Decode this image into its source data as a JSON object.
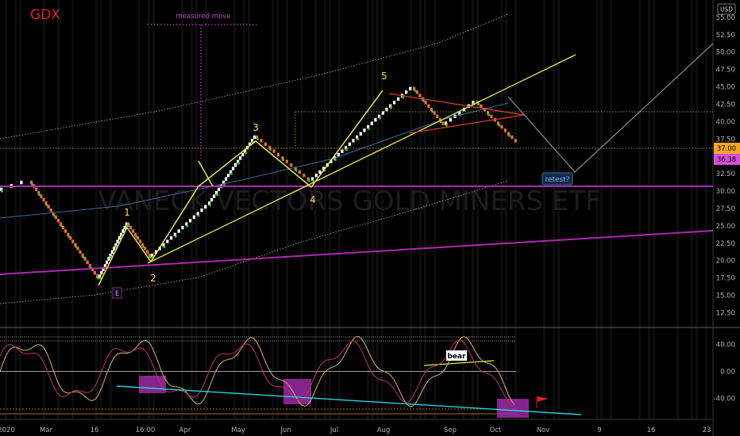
{
  "header": {
    "symbol": "GDX",
    "symbol_color": "#e0212a",
    "currency": "USD",
    "watermark": "VANECK VECTORS GOLD MINERS ETF"
  },
  "price_pane": {
    "y_ticks": [
      12.5,
      15.0,
      17.5,
      20.0,
      22.5,
      25.0,
      27.5,
      30.0,
      32.5,
      35.0,
      37.5,
      40.0,
      42.5,
      45.0,
      47.5,
      50.0,
      52.5,
      55.0
    ],
    "ylim": [
      10.5,
      57.5
    ],
    "last_price": "37.00",
    "last_price_color": "#f5a623",
    "alt_price": "36.38",
    "alt_price_color": "#d64fd8"
  },
  "oscillator_pane": {
    "y_ticks": [
      40.0,
      0.0,
      -40.0
    ],
    "y_tick_labels": [
      "40.00",
      "0.00",
      "-40.00"
    ],
    "ylim": [
      -70,
      62
    ]
  },
  "x_axis": {
    "labels": [
      "2020",
      "Mar",
      "16",
      "16:00",
      "Apr",
      "May",
      "Jun",
      "Jul",
      "Aug",
      "Sep",
      "Oct",
      "Nov",
      "9",
      "16",
      "23"
    ]
  },
  "annotations": {
    "measured_move": "measured move",
    "wave_1": "1",
    "wave_2": "2",
    "wave_3": "3",
    "wave_4": "4",
    "wave_5": "5",
    "retest": "retest?",
    "e_marker": "E",
    "bear": "bear"
  },
  "colors": {
    "up_brick": "#ffffff",
    "down_brick": "#ef6c3c",
    "green_brick": "#32c832",
    "trendline": "#e8e84a",
    "purple_line": "#b027b0",
    "channel": "#9a9a9a",
    "red_wedge": "#d33b2a",
    "cyan_line": "#27d3e0",
    "magenta_box": "#9c2aa6",
    "grid": "#1c1c1c"
  },
  "chart_data": {
    "type": "line",
    "title": "GDX",
    "x": [
      "2020",
      "Mar",
      "16",
      "16:00",
      "Apr",
      "May",
      "Jun",
      "Jul",
      "Aug",
      "Sep",
      "Oct"
    ],
    "series": [
      {
        "values": [
          30.0,
          31.5,
          17.5,
          25.5,
          20.5,
          28.0,
          38.0,
          31.5,
          42.0,
          45.0,
          39.5,
          43.0,
          37.0
        ]
      }
    ],
    "xlabel": "",
    "ylabel": "",
    "ylim": [
      10.5,
      57.5
    ],
    "grid": false,
    "log_scale": false,
    "last_value": 37.0
  }
}
